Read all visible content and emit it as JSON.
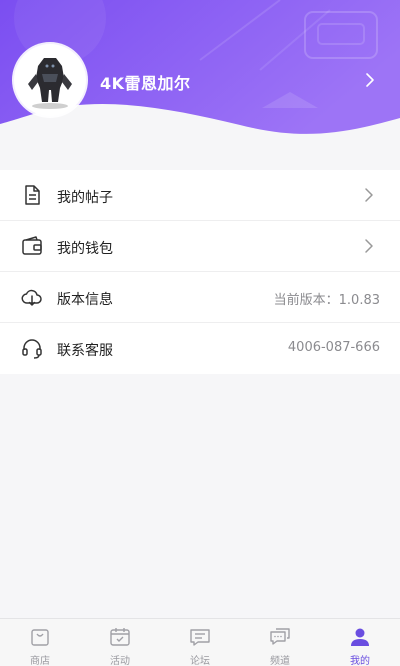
{
  "profile": {
    "username": "4K雷恩加尔"
  },
  "menu": [
    {
      "label": "我的帖子",
      "icon": "document-icon",
      "value": ""
    },
    {
      "label": "我的钱包",
      "icon": "wallet-icon",
      "value": ""
    },
    {
      "label": "版本信息",
      "icon": "cloud-icon",
      "value": "当前版本：1.0.83"
    },
    {
      "label": "联系客服",
      "icon": "headset-icon",
      "value": "4006-087-666"
    }
  ],
  "tabs": [
    {
      "label": "商店",
      "icon": "store-icon"
    },
    {
      "label": "活动",
      "icon": "calendar-icon"
    },
    {
      "label": "论坛",
      "icon": "forum-icon"
    },
    {
      "label": "频道",
      "icon": "channel-icon"
    },
    {
      "label": "我的",
      "icon": "profile-icon",
      "active": true
    }
  ],
  "colors": {
    "accent": "#6a4ee0",
    "header_gradient_start": "#7a4ff0",
    "header_gradient_end": "#9a6bf5",
    "background": "#f6f6f8"
  }
}
